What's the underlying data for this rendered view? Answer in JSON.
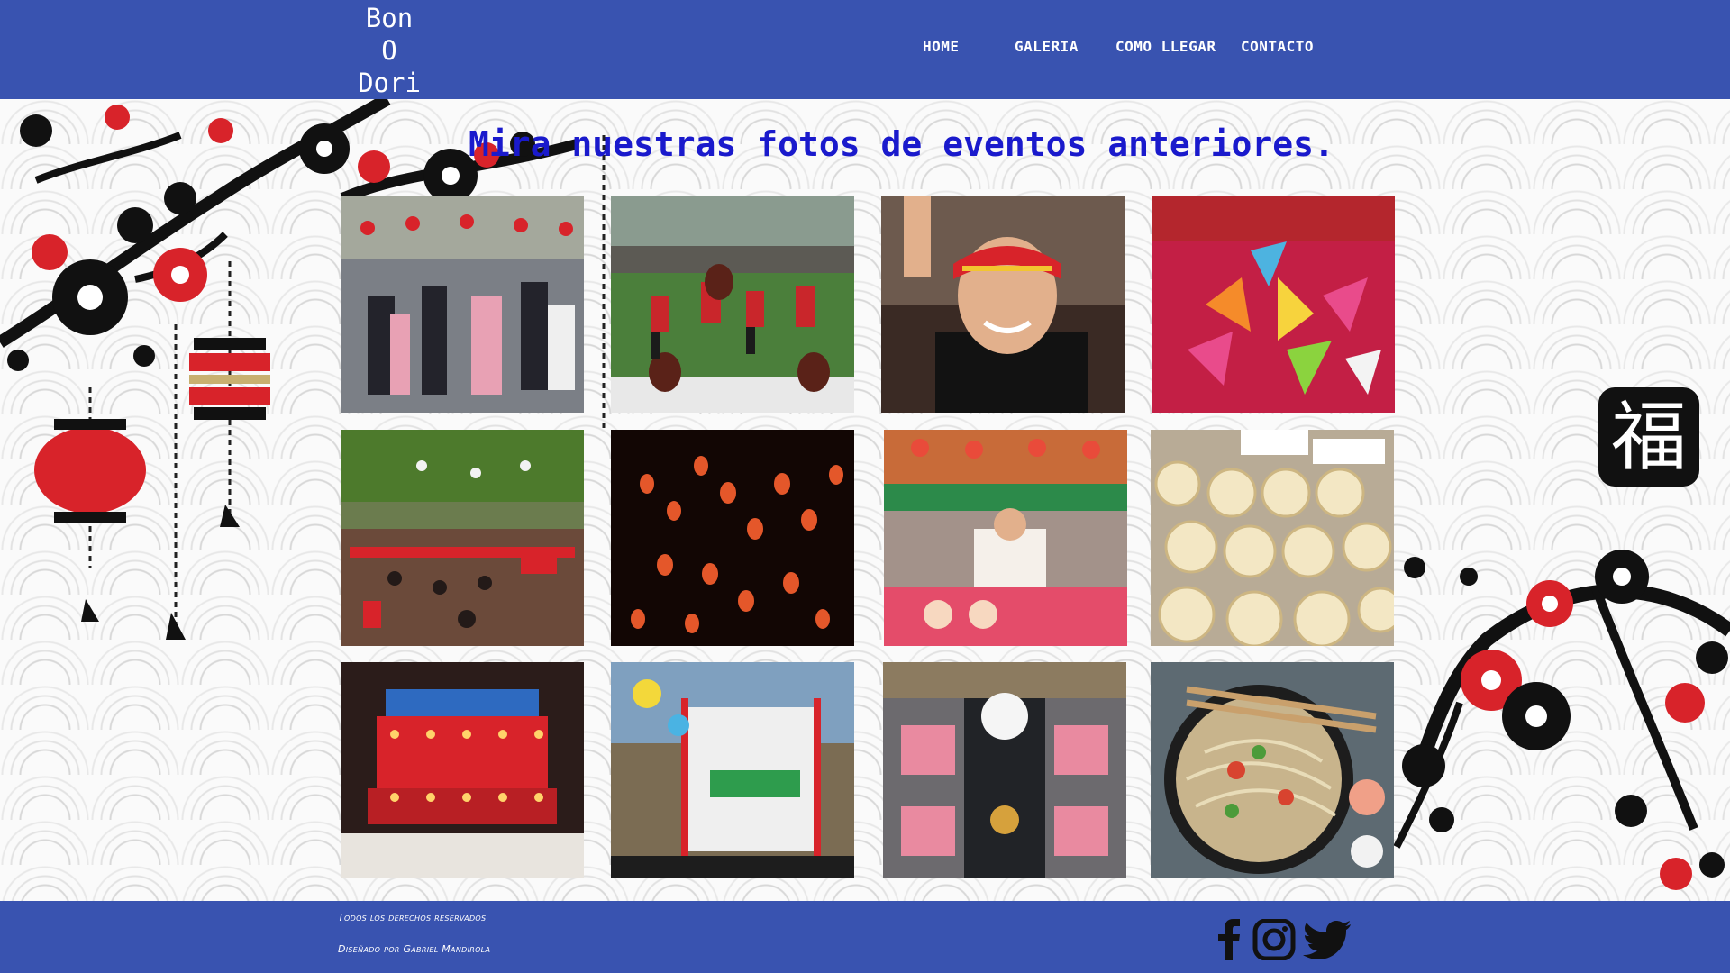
{
  "brand": {
    "line1": "Bon",
    "line2": "O",
    "line3": "Dori"
  },
  "nav": {
    "items": [
      {
        "label": "HOME"
      },
      {
        "label": "GALERIA"
      },
      {
        "label": "COMO LLEGAR"
      },
      {
        "label": "CONTACTO"
      }
    ]
  },
  "main": {
    "heading": "Mira nuestras fotos de eventos anteriores.",
    "fuku_char": "福"
  },
  "gallery": {
    "tiles": [
      {
        "icon": "bon-odori-dancers-photo"
      },
      {
        "icon": "taiko-drummers-field-photo"
      },
      {
        "icon": "smiling-man-headband-photo"
      },
      {
        "icon": "origami-cranes-photo"
      },
      {
        "icon": "festival-crowd-lanterns-photo"
      },
      {
        "icon": "hanging-lanterns-night-photo"
      },
      {
        "icon": "food-stall-vendors-photo"
      },
      {
        "icon": "japanese-buns-photo"
      },
      {
        "icon": "illuminated-yagura-photo"
      },
      {
        "icon": "stage-agroinsumos-photo"
      },
      {
        "icon": "table-setting-photo"
      },
      {
        "icon": "noodle-bowl-photo"
      }
    ]
  },
  "footer": {
    "rights": "Todos los derechos reservados",
    "designed": "Diseñado por Gabriel Mandirola",
    "social": [
      {
        "icon": "facebook-icon"
      },
      {
        "icon": "instagram-icon"
      },
      {
        "icon": "twitter-icon"
      }
    ]
  },
  "colors": {
    "header_bg": "#3953b0",
    "heading": "#1a1acc",
    "accent_red": "#d8232a"
  }
}
